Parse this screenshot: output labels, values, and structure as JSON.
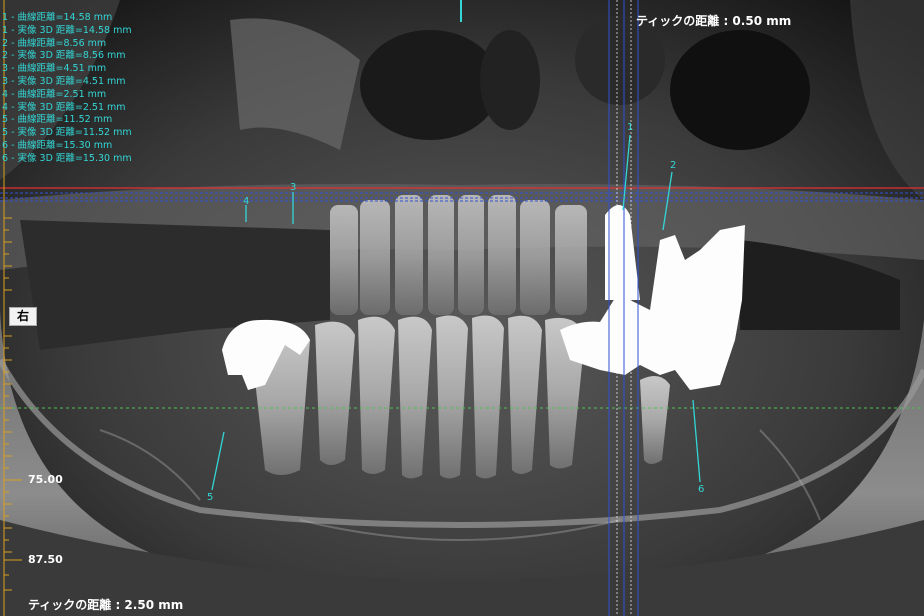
{
  "orientation_label": "右",
  "tick_distance_top": "ティックの距離 : 0.50 mm",
  "tick_distance_bottom": "ティックの距離 : 2.50 mm",
  "ruler_labels": [
    "75.00",
    "87.50"
  ],
  "measurements": [
    "1 - 曲線距離=14.58 mm",
    "1 - 実像 3D 距離=14.58 mm",
    "2 - 曲線距離=8.56 mm",
    "2 - 実像 3D 距離=8.56 mm",
    "3 - 曲線距離=4.51 mm",
    "3 - 実像 3D 距離=4.51 mm",
    "4 - 曲線距離=2.51 mm",
    "4 - 実像 3D 距離=2.51 mm",
    "5 - 曲線距離=11.52 mm",
    "5 - 実像 3D 距離=11.52 mm",
    "6 - 曲線距離=15.30 mm",
    "6 - 実像 3D 距離=15.30 mm"
  ],
  "marker_numbers": [
    "1",
    "2",
    "3",
    "4",
    "5",
    "6"
  ],
  "colors": {
    "measure": "#33d6d6",
    "ruler": "#d9a020",
    "red_line": "#e03030",
    "green_line": "#50c050",
    "blue_line": "#3050d0"
  }
}
